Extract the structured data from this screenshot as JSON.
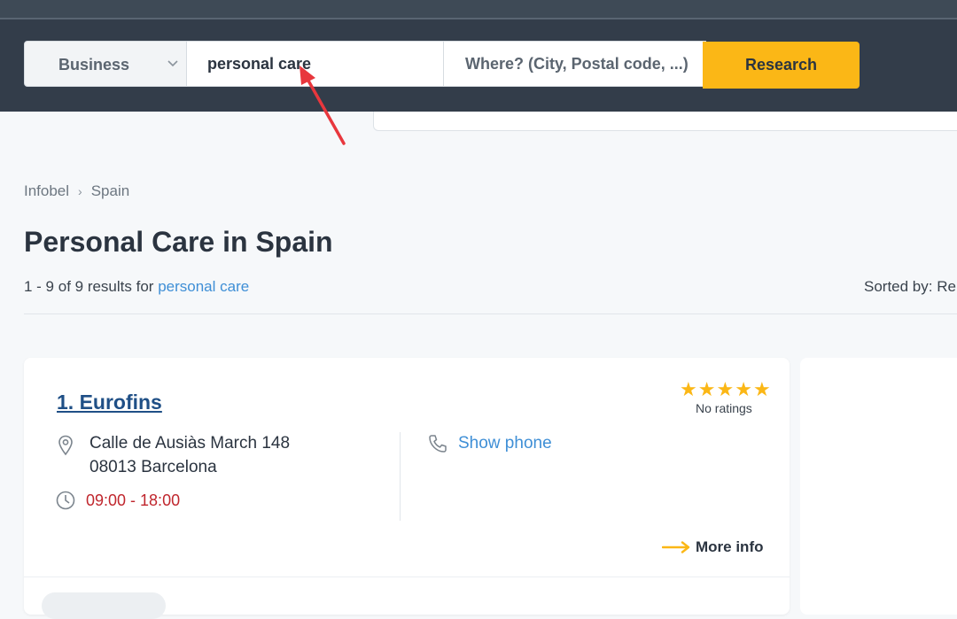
{
  "search": {
    "category": "Business",
    "what_value": "personal care",
    "where_placeholder": "Where? (City, Postal code, ...)",
    "button_label": "Research"
  },
  "breadcrumb": [
    "Infobel",
    "Spain"
  ],
  "page_title": "Personal Care in Spain",
  "results": {
    "count_prefix": "1 - 9 of 9 results for",
    "query": "personal care"
  },
  "sorted_by_label": "Sorted by:",
  "sorted_by_value": "Re",
  "listing": {
    "name": "1. Eurofins",
    "rating_label": "No ratings",
    "rating_stars": 5,
    "address_line1": "Calle de Ausiàs March 148",
    "address_line2": "08013 Barcelona",
    "hours": "09:00 - 18:00",
    "show_phone": "Show phone",
    "more_info": "More info"
  },
  "colors": {
    "header_bg": "#333d4a",
    "accent": "#fbb716",
    "link": "#3f8fd6",
    "hours_red": "#c0262d",
    "listing_name": "#1f4f86"
  }
}
